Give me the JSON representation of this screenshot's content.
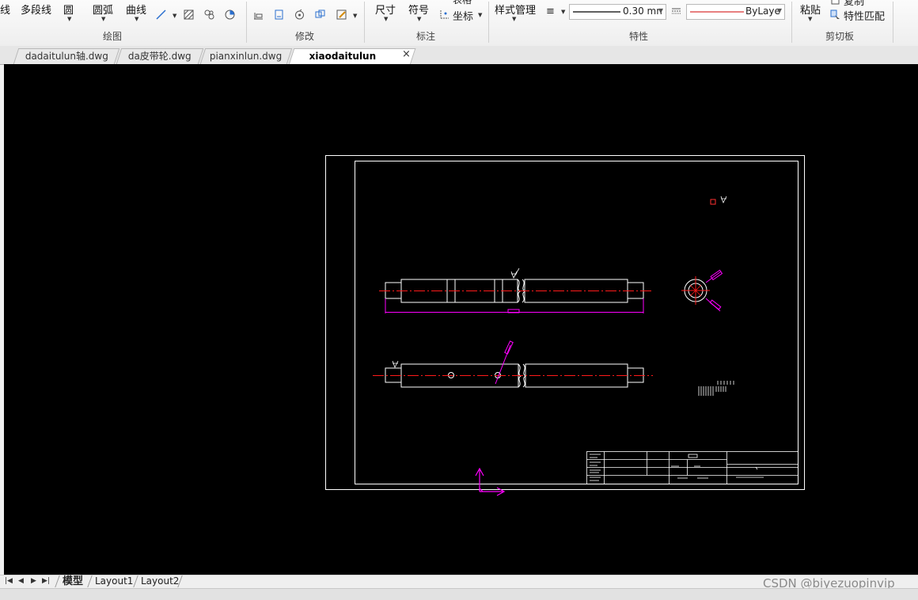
{
  "ribbon": {
    "draw": {
      "line_label": "线",
      "polyline_label": "多段线",
      "circle_label": "圆",
      "arc_label": "圆弧",
      "curve_label": "曲线",
      "panel_label": "绘图"
    },
    "modify": {
      "panel_label": "修改"
    },
    "annotation": {
      "dimension_label": "尺寸",
      "symbol_label": "符号",
      "table_label": "表格",
      "coordinate_label": "坐标",
      "panel_label": "标注"
    },
    "properties": {
      "style_manager_label": "样式管理",
      "lineweight_value": "0.30 mn",
      "linetype_value": "ByLaye",
      "panel_label": "特性"
    },
    "clipboard": {
      "paste_label": "粘贴",
      "copy_label": "复制",
      "match_label": "特性匹配",
      "panel_label": "剪切板"
    }
  },
  "tabs": [
    {
      "label": "dadaitulun轴.dwg"
    },
    {
      "label": "da皮带轮.dwg"
    },
    {
      "label": "pianxinlun.dwg"
    },
    {
      "label": "xiaodaitulun轴.dwg*"
    }
  ],
  "tab_close": "×",
  "layout_tabs": [
    {
      "label": "模型"
    },
    {
      "label": "Layout1"
    },
    {
      "label": "Layout2"
    }
  ],
  "status": {
    "watermark": "CSDN @biyezuopinvip"
  },
  "colors": {
    "canvas_background": "#000000",
    "drawing_lines": "#ffffff",
    "center_lines": "#ff0000",
    "dimension_lines": "#ff00ff",
    "ucs_icon": "#ff00ff"
  },
  "icons": {
    "nav": [
      "first-icon",
      "prev-icon",
      "next-icon",
      "last-icon"
    ]
  }
}
